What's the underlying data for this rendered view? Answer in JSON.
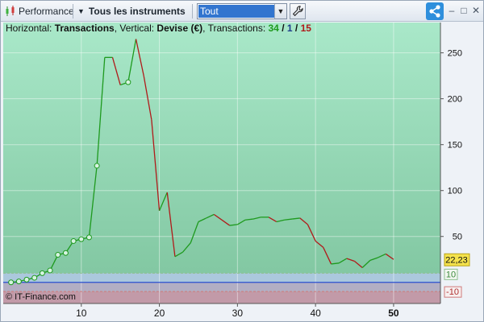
{
  "toolbar": {
    "performance_label": "Performance",
    "instruments_label": "Tous les instruments",
    "filter": {
      "selected": "Tout"
    }
  },
  "chart_header": {
    "prefix": "Horizontal: ",
    "horizontal": "Transactions",
    "vertical_prefix": ", Vertical: ",
    "vertical": "Devise (€)",
    "transactions_prefix": ", Transactions: ",
    "wins": "34",
    "sep1": " / ",
    "neutral": "1",
    "sep2": " / ",
    "losses": "15"
  },
  "copyright": "© IT-Finance.com",
  "colors": {
    "up": "#1e9a1e",
    "down": "#b01a1a",
    "zero_line": "#2a4fd0",
    "bg_top": "#a8e6c8",
    "bg_bottom": "#7fc49e"
  },
  "chart_data": {
    "type": "line",
    "xlabel": "",
    "ylabel": "",
    "x_ticks": [
      "10",
      "20",
      "30",
      "40",
      "50"
    ],
    "y_ticks": [
      "50",
      "100",
      "150",
      "200",
      "250"
    ],
    "xlim": [
      0,
      56
    ],
    "ylim": [
      -23,
      283
    ],
    "x": [
      1,
      2,
      3,
      4,
      5,
      6,
      7,
      8,
      9,
      10,
      11,
      12,
      13,
      14,
      15,
      16,
      17,
      18,
      19,
      20,
      21,
      22,
      23,
      24,
      25,
      26,
      27,
      28,
      29,
      30,
      31,
      32,
      33,
      34,
      35,
      36,
      37,
      38,
      39,
      40,
      41,
      42,
      43,
      44,
      45,
      46,
      47,
      48,
      49,
      50
    ],
    "values": [
      0,
      1,
      3,
      5,
      10,
      13,
      30,
      32,
      45,
      47,
      49,
      127,
      245,
      245,
      215,
      218,
      265,
      225,
      177,
      78,
      98,
      28,
      33,
      43,
      66,
      70,
      74,
      68,
      62,
      63,
      68,
      69,
      71,
      71,
      66,
      68,
      69,
      70,
      63,
      45,
      38,
      20,
      21,
      26,
      23,
      16,
      24,
      27,
      31,
      25
    ],
    "markers": [
      1,
      2,
      3,
      4,
      5,
      6,
      7,
      8,
      9,
      10,
      11,
      12,
      16
    ],
    "current_value": "22,23",
    "upper_band": "10",
    "lower_band": "-10",
    "upper_band_value": 10,
    "lower_band_value": -10
  }
}
